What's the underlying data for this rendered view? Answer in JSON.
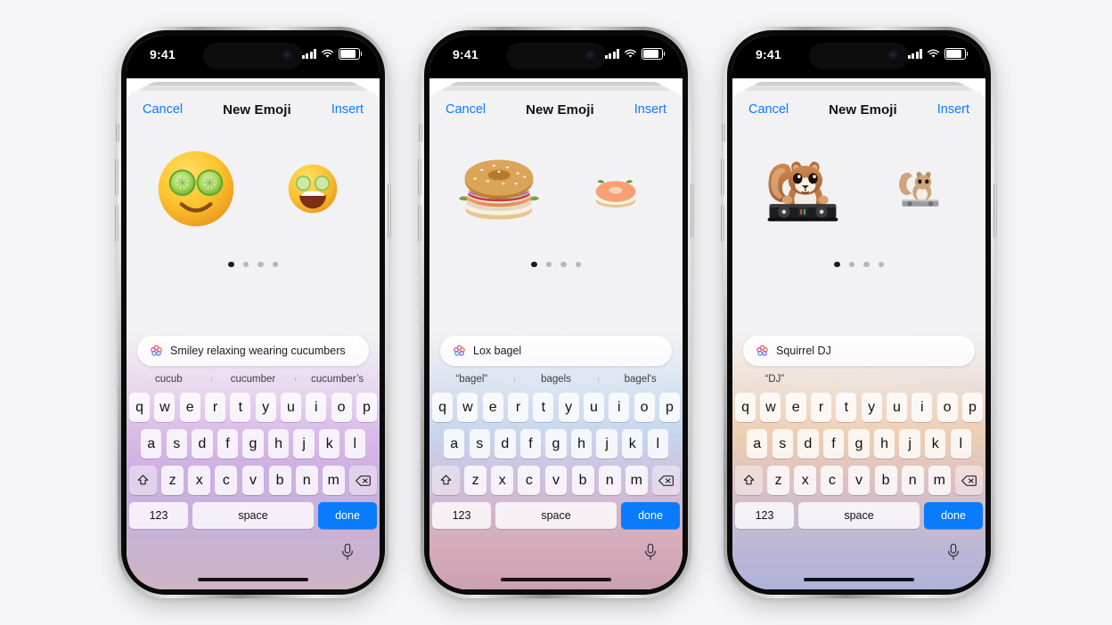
{
  "status_bar": {
    "time": "9:41",
    "icons": [
      "cellular-signal-icon",
      "wifi-icon",
      "battery-icon"
    ]
  },
  "nav": {
    "cancel_label": "Cancel",
    "title": "New Emoji",
    "insert_label": "Insert"
  },
  "colors": {
    "accent_blue": "#0a7bfd",
    "done_key": "#0a7bfd",
    "dot_active": "#1c1c1e",
    "dot_inactive": "#b6b6bb",
    "sheet_bg": "#f2f2f4",
    "title_text": "#111111"
  },
  "keyboard": {
    "row1": [
      "q",
      "w",
      "e",
      "r",
      "t",
      "y",
      "u",
      "i",
      "o",
      "p"
    ],
    "row2": [
      "a",
      "s",
      "d",
      "f",
      "g",
      "h",
      "j",
      "k",
      "l"
    ],
    "row3": [
      "z",
      "x",
      "c",
      "v",
      "b",
      "n",
      "m"
    ],
    "shift_icon": "shift-icon",
    "backspace_icon": "backspace-icon",
    "numbers_label": "123",
    "space_label": "space",
    "done_label": "done",
    "mic_icon": "microphone-icon"
  },
  "page_dots": {
    "count": 4,
    "active_index": 0
  },
  "phones": [
    {
      "id": "phone-1",
      "prompt_value": "Smiley relaxing wearing cucumbers",
      "ai_icon": "apple-intelligence-icon",
      "suggestions": [
        "cucub",
        "cucumber",
        "cucumber’s"
      ],
      "emoji_main": "smiley-with-cucumber-slices-on-eyes",
      "emoji_next": "smiling-face-with-cucumber-eyes-variant"
    },
    {
      "id": "phone-2",
      "prompt_value": "Lox bagel",
      "ai_icon": "apple-intelligence-icon",
      "suggestions": [
        "“bagel”",
        "bagels",
        "bagel's"
      ],
      "emoji_main": "lox-bagel-sandwich",
      "emoji_next": "open-faced-lox-bagel"
    },
    {
      "id": "phone-3",
      "prompt_value": "Squirrel DJ",
      "ai_icon": "apple-intelligence-icon",
      "suggestions": [
        "“DJ”",
        "",
        ""
      ],
      "emoji_main": "squirrel-dj-at-turntables",
      "emoji_next": "squirrel-dj-variant"
    }
  ]
}
